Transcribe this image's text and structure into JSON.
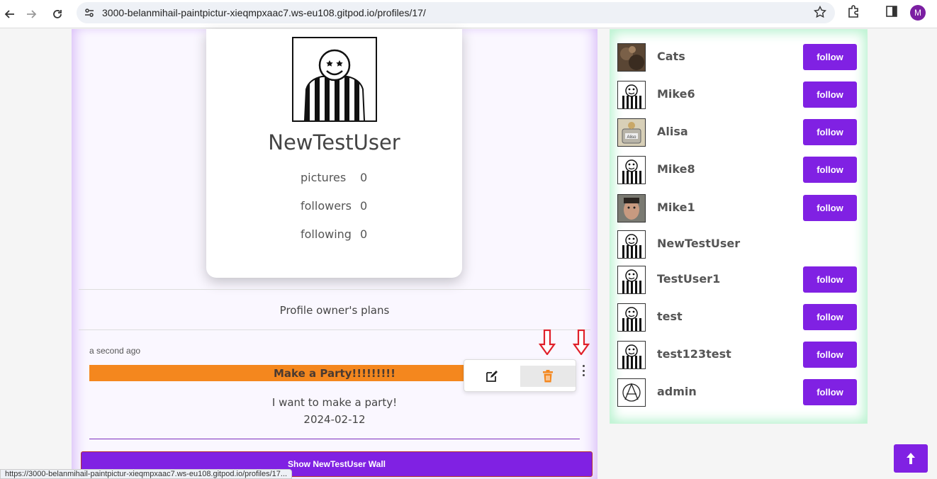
{
  "browser": {
    "url": "3000-belanmihail-paintpictur-xieqmpxaac7.ws-eu108.gitpod.io/profiles/17/",
    "profile_initial": "M",
    "status_url": "https://3000-belanmihail-paintpictur-xieqmpxaac7.ws-eu108.gitpod.io/profiles/17..."
  },
  "profile": {
    "name": "NewTestUser",
    "stats": [
      {
        "label": "pictures",
        "value": "0"
      },
      {
        "label": "followers",
        "value": "0"
      },
      {
        "label": "following",
        "value": "0"
      }
    ]
  },
  "plans": {
    "section_title": "Profile owner's plans",
    "item": {
      "time": "a second ago",
      "title": "Make a Party!!!!!!!!!",
      "description": "I want to make a party!",
      "date": "2024-02-12"
    },
    "show_wall_label": "Show NewTestUser Wall"
  },
  "users": {
    "follow_label": "follow",
    "items": [
      {
        "name": "Cats",
        "avatar": "cat-photo",
        "followable": true
      },
      {
        "name": "Mike6",
        "avatar": "striped-smiley",
        "followable": true
      },
      {
        "name": "Alisa",
        "avatar": "alisa-photo",
        "followable": true
      },
      {
        "name": "Mike8",
        "avatar": "striped-smiley",
        "followable": true
      },
      {
        "name": "Mike1",
        "avatar": "man-photo",
        "followable": true
      },
      {
        "name": "NewTestUser",
        "avatar": "striped-smiley",
        "followable": false
      },
      {
        "name": "TestUser1",
        "avatar": "striped-smiley",
        "followable": true
      },
      {
        "name": "test",
        "avatar": "striped-smiley",
        "followable": true
      },
      {
        "name": "test123test",
        "avatar": "striped-smiley",
        "followable": true
      },
      {
        "name": "admin",
        "avatar": "anarchy-symbol",
        "followable": true
      }
    ]
  },
  "colors": {
    "accent": "#8021e3",
    "plan_bar": "#f4871e",
    "delete_icon": "#f4871e",
    "annotation_arrow": "#e0202a"
  }
}
